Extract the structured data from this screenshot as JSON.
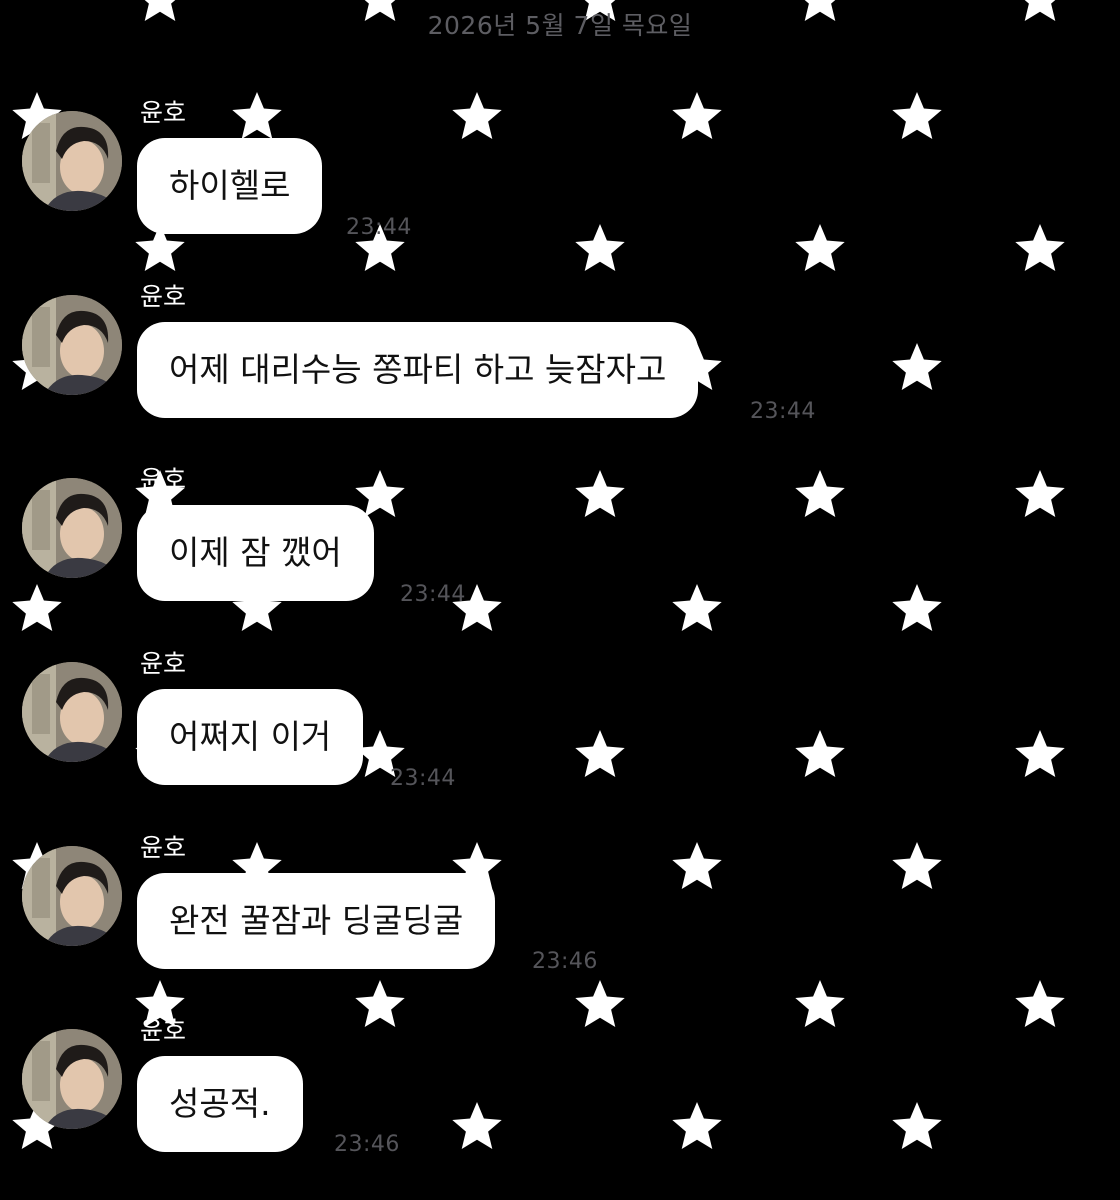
{
  "chat": {
    "date_header": "2026년 5월 7일 목요일",
    "messages": [
      {
        "sender": "윤호",
        "text": "하이헬로",
        "time": "23:44"
      },
      {
        "sender": "윤호",
        "text": "어제 대리수능 쫑파티 하고 늦잠자고",
        "time": "23:44"
      },
      {
        "sender": "윤호",
        "text": "이제 잠 깼어",
        "time": "23:44"
      },
      {
        "sender": "윤호",
        "text": "어쩌지 이거",
        "time": "23:44"
      },
      {
        "sender": "윤호",
        "text": "완전 꿀잠과 딩굴딩굴",
        "time": "23:46"
      },
      {
        "sender": "윤호",
        "text": "성공적.",
        "time": "23:46"
      }
    ]
  },
  "colors": {
    "background": "#000000",
    "bubble": "#ffffff",
    "timestamp": "#55555a",
    "date_header": "#5d5d62"
  },
  "icons": {
    "background_pattern": "star-icon",
    "profile": "avatar"
  }
}
